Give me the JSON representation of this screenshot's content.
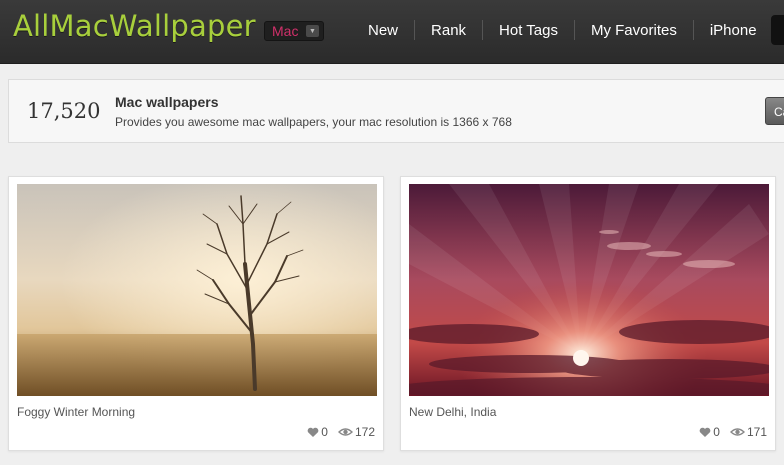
{
  "header": {
    "logo": "AllMacWallpaper",
    "platform": "Mac",
    "nav": [
      "New",
      "Rank",
      "Hot Tags",
      "My Favorites",
      "iPhone"
    ]
  },
  "info": {
    "count": "17,520",
    "title": "Mac wallpapers",
    "description": "Provides you awesome mac wallpapers, your mac resolution is 1366 x 768",
    "button": "Ca"
  },
  "wallpapers": [
    {
      "title": "Foggy Winter Morning",
      "likes": "0",
      "views": "172"
    },
    {
      "title": "New Delhi, India",
      "likes": "0",
      "views": "171"
    }
  ],
  "colors": {
    "logo_green": "#a8cf3c",
    "platform_pink": "#d0306a",
    "header_bg": "#333333"
  }
}
